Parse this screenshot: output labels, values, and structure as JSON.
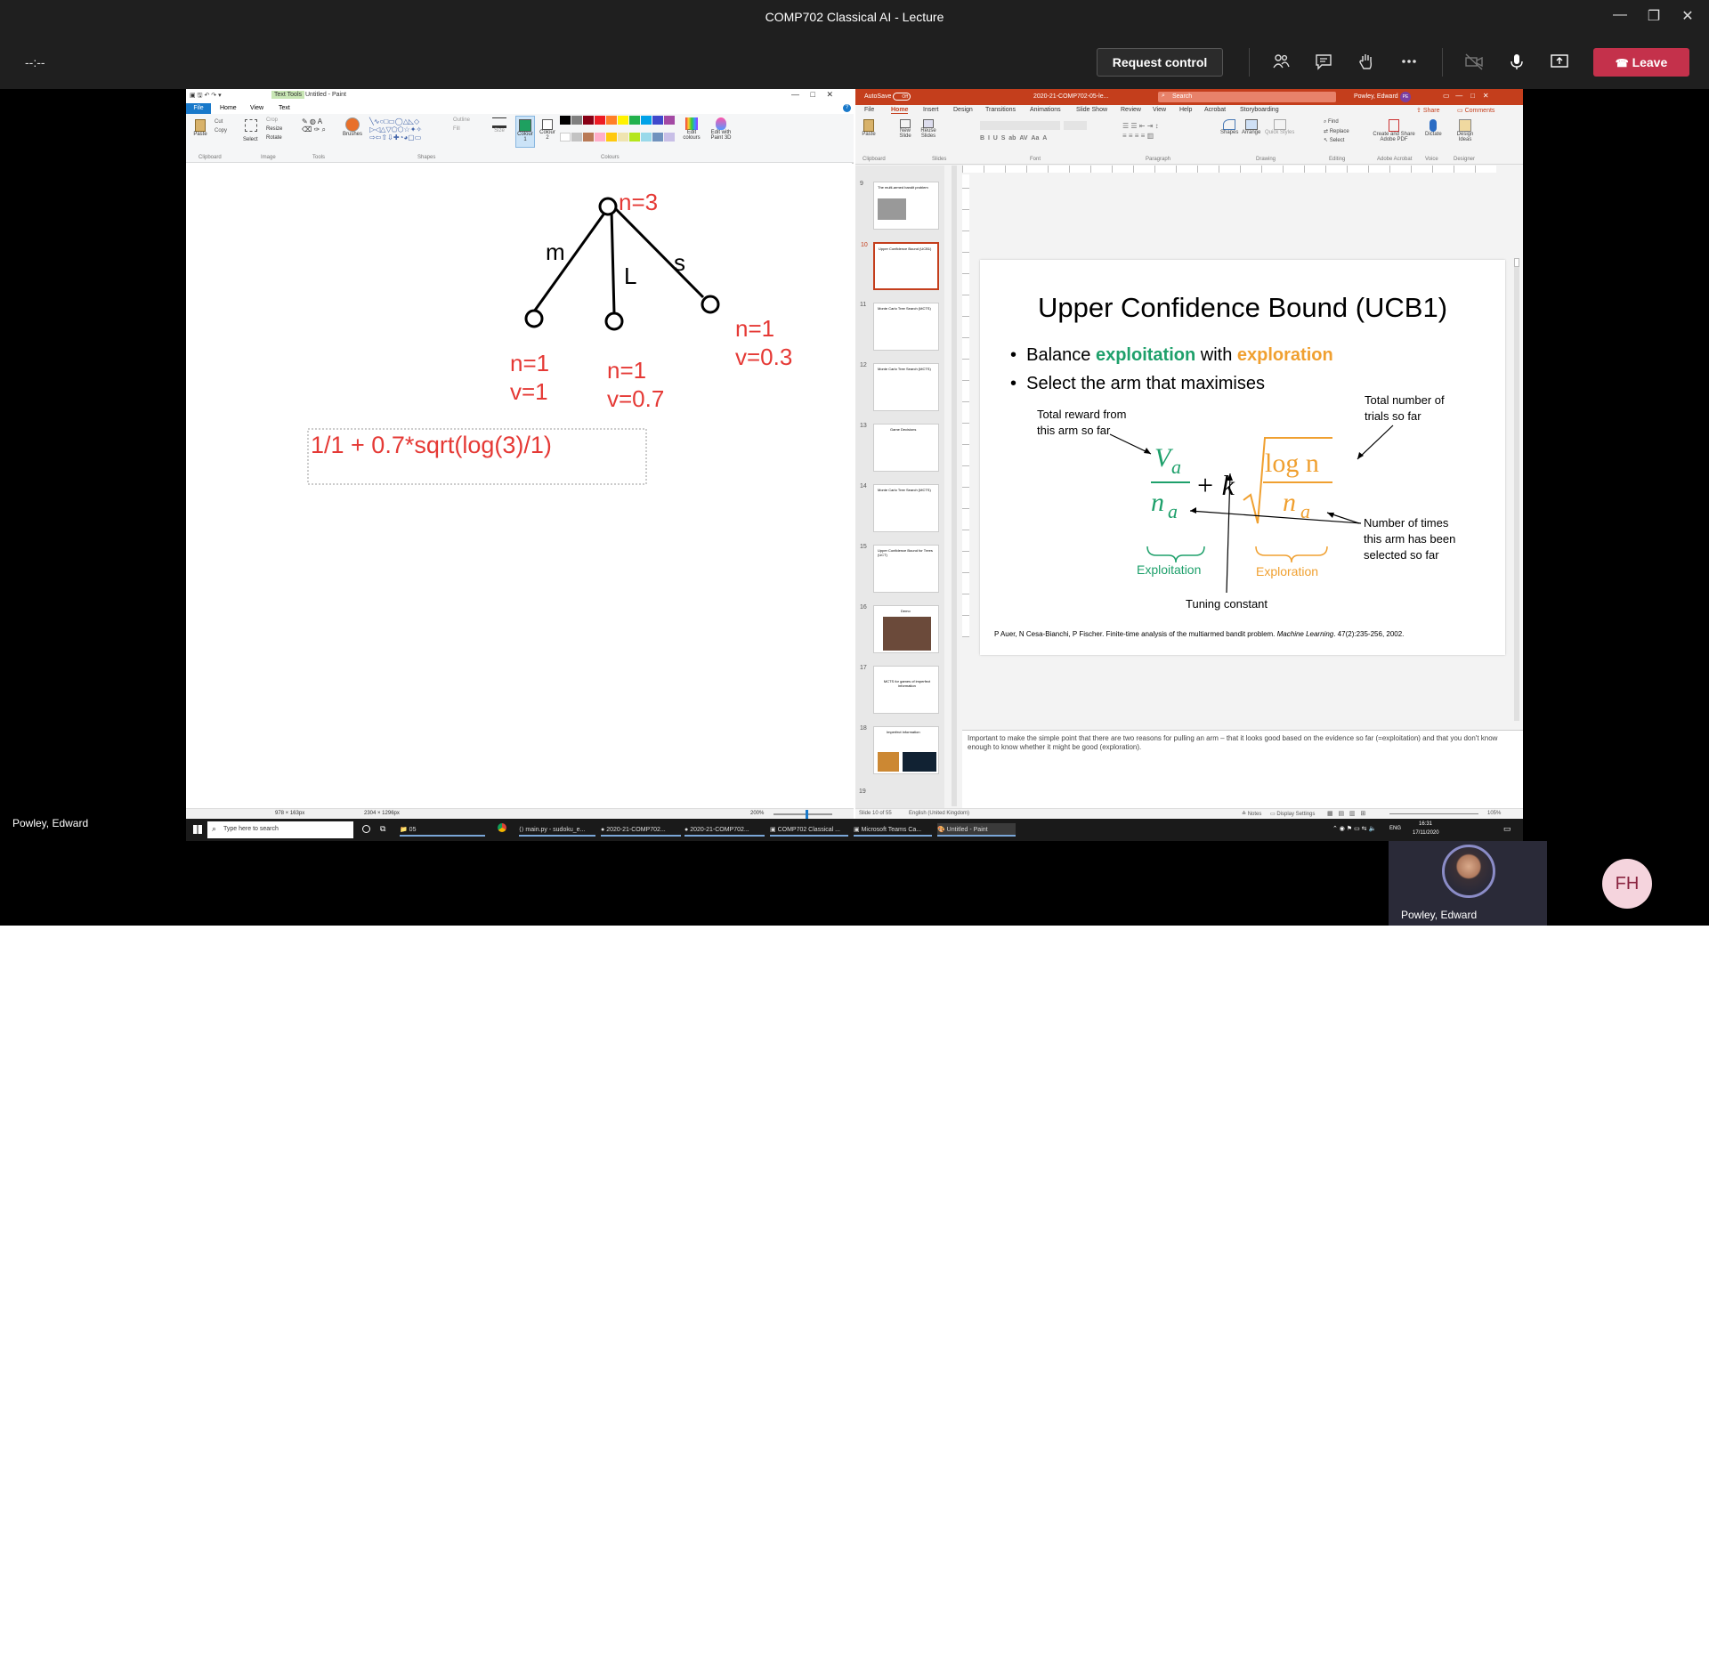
{
  "window": {
    "title": "COMP702 Classical AI - Lecture",
    "minimize": "—",
    "maximize": "❐",
    "close": "✕"
  },
  "meeting": {
    "timer": "--:--",
    "request_control": "Request control",
    "leave": "Leave",
    "presenter_name": "Powley, Edward",
    "video_name": "Powley, Edward",
    "avatar_initials": "FH",
    "icons": [
      "people-icon",
      "chat-icon",
      "raise-hand-icon",
      "more-icon",
      "camera-off-icon",
      "mic-icon",
      "share-icon"
    ]
  },
  "paint": {
    "title": "Untitled - Paint",
    "text_tools_tab": "Text Tools",
    "tabs": [
      "File",
      "Home",
      "View",
      "Text"
    ],
    "ribbon_groups": [
      "Clipboard",
      "Image",
      "Tools",
      "Shapes",
      "Colours"
    ],
    "ribbon_buttons": [
      "Paste",
      "Cut",
      "Copy",
      "Select",
      "Crop",
      "Resize",
      "Rotate",
      "Brushes",
      "Outline",
      "Fill",
      "Size",
      "Colour 1",
      "Colour 2",
      "Edit colours",
      "Edit with Paint 3D"
    ],
    "drawing": {
      "root_label": "n=3",
      "edge_labels": [
        "m",
        "L",
        "s"
      ],
      "child_labels": [
        {
          "n": "n=1",
          "v": "v=1"
        },
        {
          "n": "n=1",
          "v": "v=0.7"
        },
        {
          "n": "n=1",
          "v": "v=0.3"
        }
      ],
      "formula": "1/1 + 0.7*sqrt(log(3)/1)"
    },
    "status": {
      "selection": "978 × 163px",
      "size": "2304 × 1296px",
      "zoom": "200%"
    }
  },
  "powerpoint": {
    "autosave": "AutoSave",
    "autosave_state": "Off",
    "file_name": "2020-21-COMP702-05-le...",
    "search_placeholder": "Search",
    "user": "Powley, Edward",
    "user_initials": "PE",
    "tabs": [
      "File",
      "Home",
      "Insert",
      "Design",
      "Transitions",
      "Animations",
      "Slide Show",
      "Review",
      "View",
      "Help",
      "Acrobat",
      "Storyboarding"
    ],
    "share": "Share",
    "comments": "Comments",
    "ribbon_groups": [
      "Clipboard",
      "Slides",
      "Font",
      "Paragraph",
      "Drawing",
      "Editing",
      "Adobe Acrobat",
      "Voice",
      "Designer"
    ],
    "ribbon_buttons": [
      "Paste",
      "New Slide",
      "Reuse Slides",
      "Shapes",
      "Arrange",
      "Quick Styles",
      "Find",
      "Replace",
      "Select",
      "Create and Share Adobe PDF",
      "Dictate",
      "Design Ideas"
    ],
    "thumbnails": [
      {
        "num": "9",
        "title": "The multi-armed bandit problem"
      },
      {
        "num": "10",
        "title": "Upper Confidence Bound (UCB1)"
      },
      {
        "num": "11",
        "title": "Monte Carlo Tree Search (MCTS)"
      },
      {
        "num": "12",
        "title": "Monte Carlo Tree Search (MCTS)"
      },
      {
        "num": "13",
        "title": "Game Decisions"
      },
      {
        "num": "14",
        "title": "Monte Carlo Tree Search (MCTS)"
      },
      {
        "num": "15",
        "title": "Upper Confidence Bound for Trees (UCT)"
      },
      {
        "num": "16",
        "title": "Demo"
      },
      {
        "num": "17",
        "title": "MCTS for games of imperfect information"
      },
      {
        "num": "18",
        "title": "Imperfect information"
      },
      {
        "num": "19",
        "title": ""
      }
    ],
    "slide": {
      "title": "Upper Confidence Bound (UCB1)",
      "bullet1_pre": "Balance ",
      "bullet1_exploit": "exploitation",
      "bullet1_mid": " with ",
      "bullet1_explore": "exploration",
      "bullet2": "Select the arm that maximises",
      "ann_total_reward": [
        "Total reward from",
        "this arm so far"
      ],
      "ann_total_trials": [
        "Total number of",
        "trials so far"
      ],
      "ann_times_selected": [
        "Number of times",
        "this arm has been",
        "selected so far"
      ],
      "ann_exploitation": "Exploitation",
      "ann_exploration": "Exploration",
      "ann_tuning": "Tuning constant",
      "formula_Va": "V",
      "formula_sub_a": "a",
      "formula_na": "n",
      "formula_plus_k": "+ k",
      "formula_log": "log n",
      "citation_pre": "P Auer, N Cesa-Bianchi, P Fischer. Finite-time analysis of the multiarmed bandit problem. ",
      "citation_journal": "Machine Learning",
      "citation_post": ". 47(2):235-256, 2002.",
      "colors": {
        "exploitation": "#1ea06b",
        "exploration": "#f0a030"
      }
    },
    "notes": "Important to make the simple point that there are two reasons for pulling an arm – that it looks good based on the evidence so far (=exploitation) and that you don't know enough to know whether it might be good (exploration).",
    "status": {
      "slide_counter": "Slide 10 of 55",
      "language": "English (United Kingdom)",
      "notes": "Notes",
      "display_settings": "Display Settings",
      "zoom": "105%"
    }
  },
  "taskbar": {
    "search_placeholder": "Type here to search",
    "apps": [
      "05",
      "main.py - sudoku_e...",
      "2020-21-COMP702...",
      "2020-21-COMP702...",
      "COMP702 Classical ...",
      "Microsoft Teams Ca...",
      "Untitled - Paint"
    ],
    "lang": "ENG",
    "time": "16:31",
    "date": "17/11/2020"
  }
}
